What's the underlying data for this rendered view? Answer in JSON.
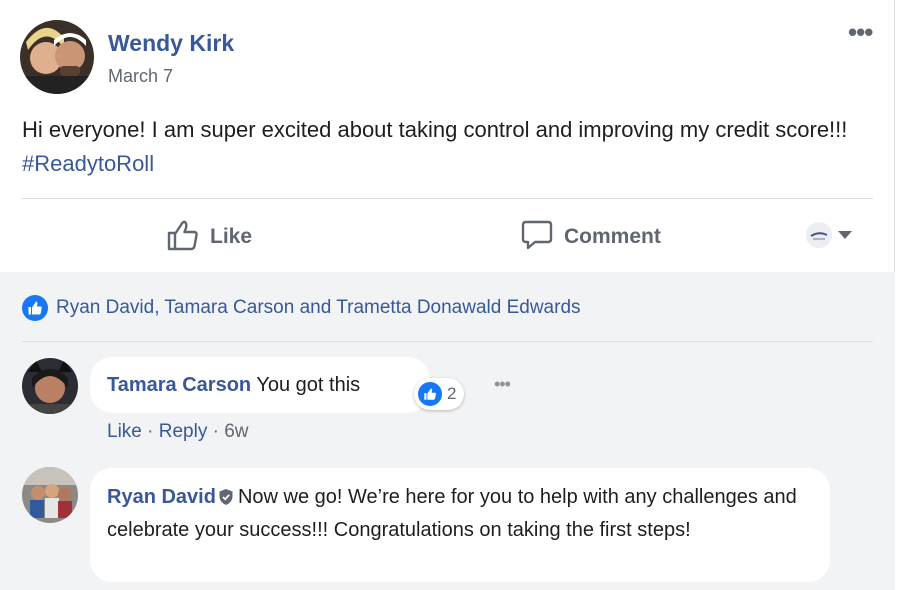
{
  "post": {
    "author": "Wendy Kirk",
    "date": "March 7",
    "more_label": "•••",
    "text": "Hi everyone! I am super excited about taking control and improving my credit score!!! ",
    "hashtag": "#ReadytoRoll"
  },
  "actions": {
    "like_label": "Like",
    "comment_label": "Comment"
  },
  "reactions": {
    "names": "Ryan David, Tamara Carson and Trametta Donawald Edwards"
  },
  "comments": [
    {
      "author": "Tamara Carson",
      "text": "You got this",
      "reaction_count": "2",
      "more_label": "•••",
      "meta": {
        "like": "Like",
        "sep1": " · ",
        "reply": "Reply",
        "sep2": " · ",
        "age": "6w"
      }
    },
    {
      "author": "Ryan David",
      "text": "Now we go! We’re here for you to help with any challenges and celebrate your success!!! Congratulations on taking the first steps!"
    }
  ],
  "colors": {
    "link_blue": "#385898",
    "like_blue": "#1877f2",
    "muted_gray": "#606770",
    "comment_area_bg": "#f2f3f5"
  },
  "icons": {
    "like": "thumbs-up-outline-icon",
    "comment": "speech-bubble-icon",
    "reaction": "like-badge-icon",
    "verified": "shield-icon",
    "share_chooser": "caret-down-icon"
  }
}
